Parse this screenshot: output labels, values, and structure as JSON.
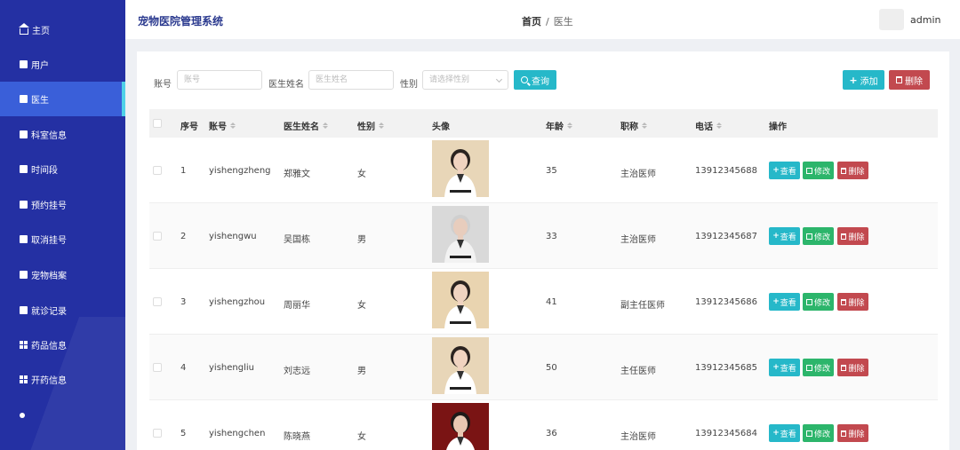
{
  "sidebar": {
    "items": [
      {
        "label": "主页",
        "icon": "home-icon"
      },
      {
        "label": "用户",
        "icon": "user-icon"
      },
      {
        "label": "医生",
        "icon": "doctor-icon"
      },
      {
        "label": "科室信息",
        "icon": "department-icon"
      },
      {
        "label": "时间段",
        "icon": "time-icon"
      },
      {
        "label": "预约挂号",
        "icon": "appointment-icon"
      },
      {
        "label": "取消挂号",
        "icon": "cancel-icon"
      },
      {
        "label": "宠物档案",
        "icon": "archive-icon"
      },
      {
        "label": "就诊记录",
        "icon": "record-icon"
      },
      {
        "label": "药品信息",
        "icon": "medicine-icon"
      },
      {
        "label": "开药信息",
        "icon": "prescription-icon"
      }
    ],
    "active_index": 2,
    "colors": {
      "bg": "#2430a3",
      "active": "#3a5fd9",
      "indicator": "#4fd1e8"
    }
  },
  "header": {
    "title": "宠物医院管理系统",
    "breadcrumb": {
      "home": "首页",
      "separator": "/",
      "current": "医生"
    },
    "username": "admin"
  },
  "search": {
    "account_label": "账号",
    "account_placeholder": "账号",
    "name_label": "医生姓名",
    "name_placeholder": "医生姓名",
    "gender_label": "性别",
    "gender_placeholder": "请选择性别",
    "query_button": "查询"
  },
  "toolbar": {
    "add_button": "添加",
    "delete_button": "删除"
  },
  "table": {
    "headers": {
      "index": "序号",
      "account": "账号",
      "name": "医生姓名",
      "gender": "性别",
      "avatar": "头像",
      "age": "年龄",
      "title": "职称",
      "phone": "电话",
      "actions": "操作"
    },
    "rows": [
      {
        "index": "1",
        "account": "yishengzheng",
        "name": "郑雅文",
        "gender": "女",
        "age": "35",
        "title": "主治医师",
        "phone": "13912345688"
      },
      {
        "index": "2",
        "account": "yishengwu",
        "name": "吴国栋",
        "gender": "男",
        "age": "33",
        "title": "主治医师",
        "phone": "13912345687"
      },
      {
        "index": "3",
        "account": "yishengzhou",
        "name": "周丽华",
        "gender": "女",
        "age": "41",
        "title": "副主任医师",
        "phone": "13912345686"
      },
      {
        "index": "4",
        "account": "yishengliu",
        "name": "刘志远",
        "gender": "男",
        "age": "50",
        "title": "主任医师",
        "phone": "13912345685"
      },
      {
        "index": "5",
        "account": "yishengchen",
        "name": "陈晓燕",
        "gender": "女",
        "age": "36",
        "title": "主治医师",
        "phone": "13912345684"
      }
    ],
    "action_labels": {
      "view": "查看",
      "edit": "修改",
      "delete": "删除"
    }
  },
  "colors": {
    "primary": "#26b8c9",
    "success": "#2cb56b",
    "danger": "#c2494f"
  }
}
